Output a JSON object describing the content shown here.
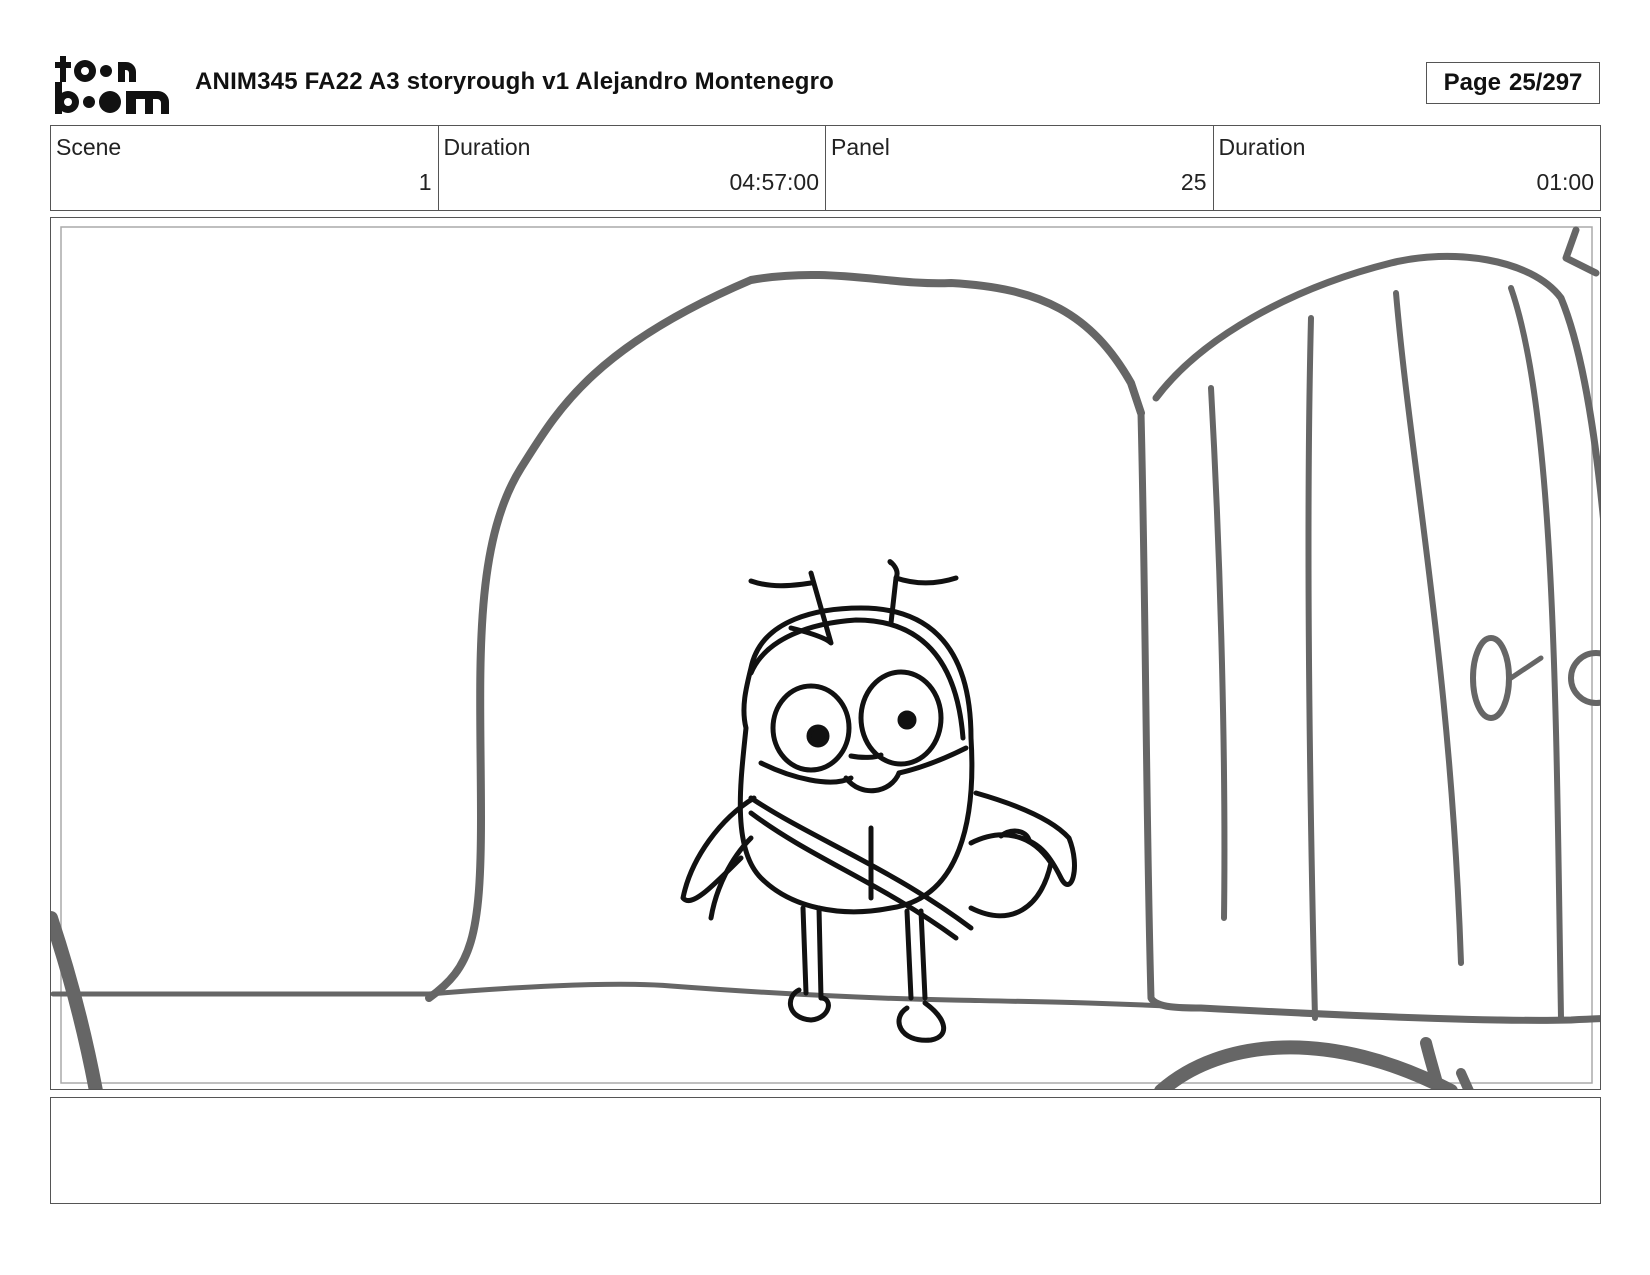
{
  "header": {
    "logo_top": "to•n",
    "logo_bottom": "b••m",
    "title": "ANIM345  FA22  A3 storyrough v1 Alejandro Montenegro",
    "page_label": "Page",
    "page_value": "25/297"
  },
  "info": {
    "scene_label": "Scene",
    "scene_value": "1",
    "scene_duration_label": "Duration",
    "scene_duration_value": "04:57:00",
    "panel_label": "Panel",
    "panel_value": "25",
    "panel_duration_label": "Duration",
    "panel_duration_value": "01:00"
  },
  "notes": {
    "text": ""
  },
  "colors": {
    "sketch_gray": "#666666",
    "sketch_black": "#111111",
    "border": "#555555"
  }
}
